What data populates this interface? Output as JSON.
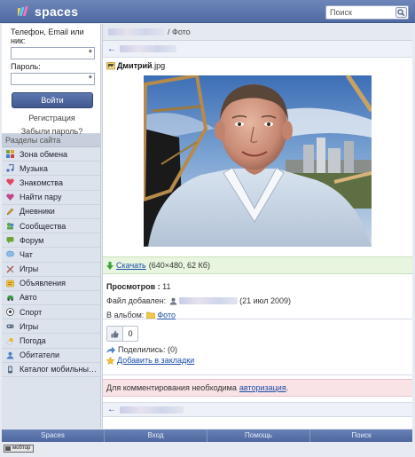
{
  "header": {
    "logo_text": "spaces",
    "search_placeholder": "Поиск"
  },
  "login": {
    "login_label": "Телефон, Email или ник:",
    "password_label": "Пароль:",
    "required_mark": "*",
    "submit_label": "Войти",
    "register_link": "Регистрация",
    "forgot_link": "Забыли пароль?"
  },
  "sidebar": {
    "section_title": "Разделы сайта",
    "items": [
      {
        "label": "Зона обмена",
        "icon": "grid-icon"
      },
      {
        "label": "Музыка",
        "icon": "music-note-icon"
      },
      {
        "label": "Знакомства",
        "icon": "heart-icon"
      },
      {
        "label": "Найти пару",
        "icon": "heart-pair-icon"
      },
      {
        "label": "Дневники",
        "icon": "pencil-icon"
      },
      {
        "label": "Сообщества",
        "icon": "community-icon"
      },
      {
        "label": "Форум",
        "icon": "forum-icon"
      },
      {
        "label": "Чат",
        "icon": "chat-bubble-icon"
      },
      {
        "label": "Игры",
        "icon": "swords-icon"
      },
      {
        "label": "Объявления",
        "icon": "ads-icon"
      },
      {
        "label": "Авто",
        "icon": "car-icon"
      },
      {
        "label": "Спорт",
        "icon": "ball-icon"
      },
      {
        "label": "Игры",
        "icon": "gamepad-icon"
      },
      {
        "label": "Погода",
        "icon": "weather-icon"
      },
      {
        "label": "Обитатели",
        "icon": "user-icon"
      },
      {
        "label": "Каталог мобильных ...",
        "icon": "phone-icon"
      }
    ]
  },
  "main": {
    "breadcrumb_sep": "/ Фото",
    "back_arrow": "←",
    "file_name_bold": "Дмитрий",
    "file_ext": ".jpg",
    "download_label": "Скачать",
    "download_size": "(640×480, 62 Кб)",
    "views_label": "Просмотров :",
    "views_count": "11",
    "added_label": "Файл добавлен:",
    "added_date": "(21 июл 2009)",
    "album_label": "В альбом:",
    "album_link": "Фото",
    "like_count": "0",
    "shared_label": "Поделились: (0)",
    "bookmark_link": "Добавить в закладки",
    "comment_notice": "Для комментирования необходима",
    "comment_auth_link": "авторизация",
    "comment_dot": "."
  },
  "footer": {
    "items": [
      "Spaces",
      "Вход",
      "Помощь",
      "Поиск"
    ],
    "counter": "мобтор"
  },
  "colors": {
    "header": "#5a74ab",
    "link": "#1d4ea8",
    "download_bg": "#e8f6e0",
    "notice_bg": "#f9e3e6"
  }
}
